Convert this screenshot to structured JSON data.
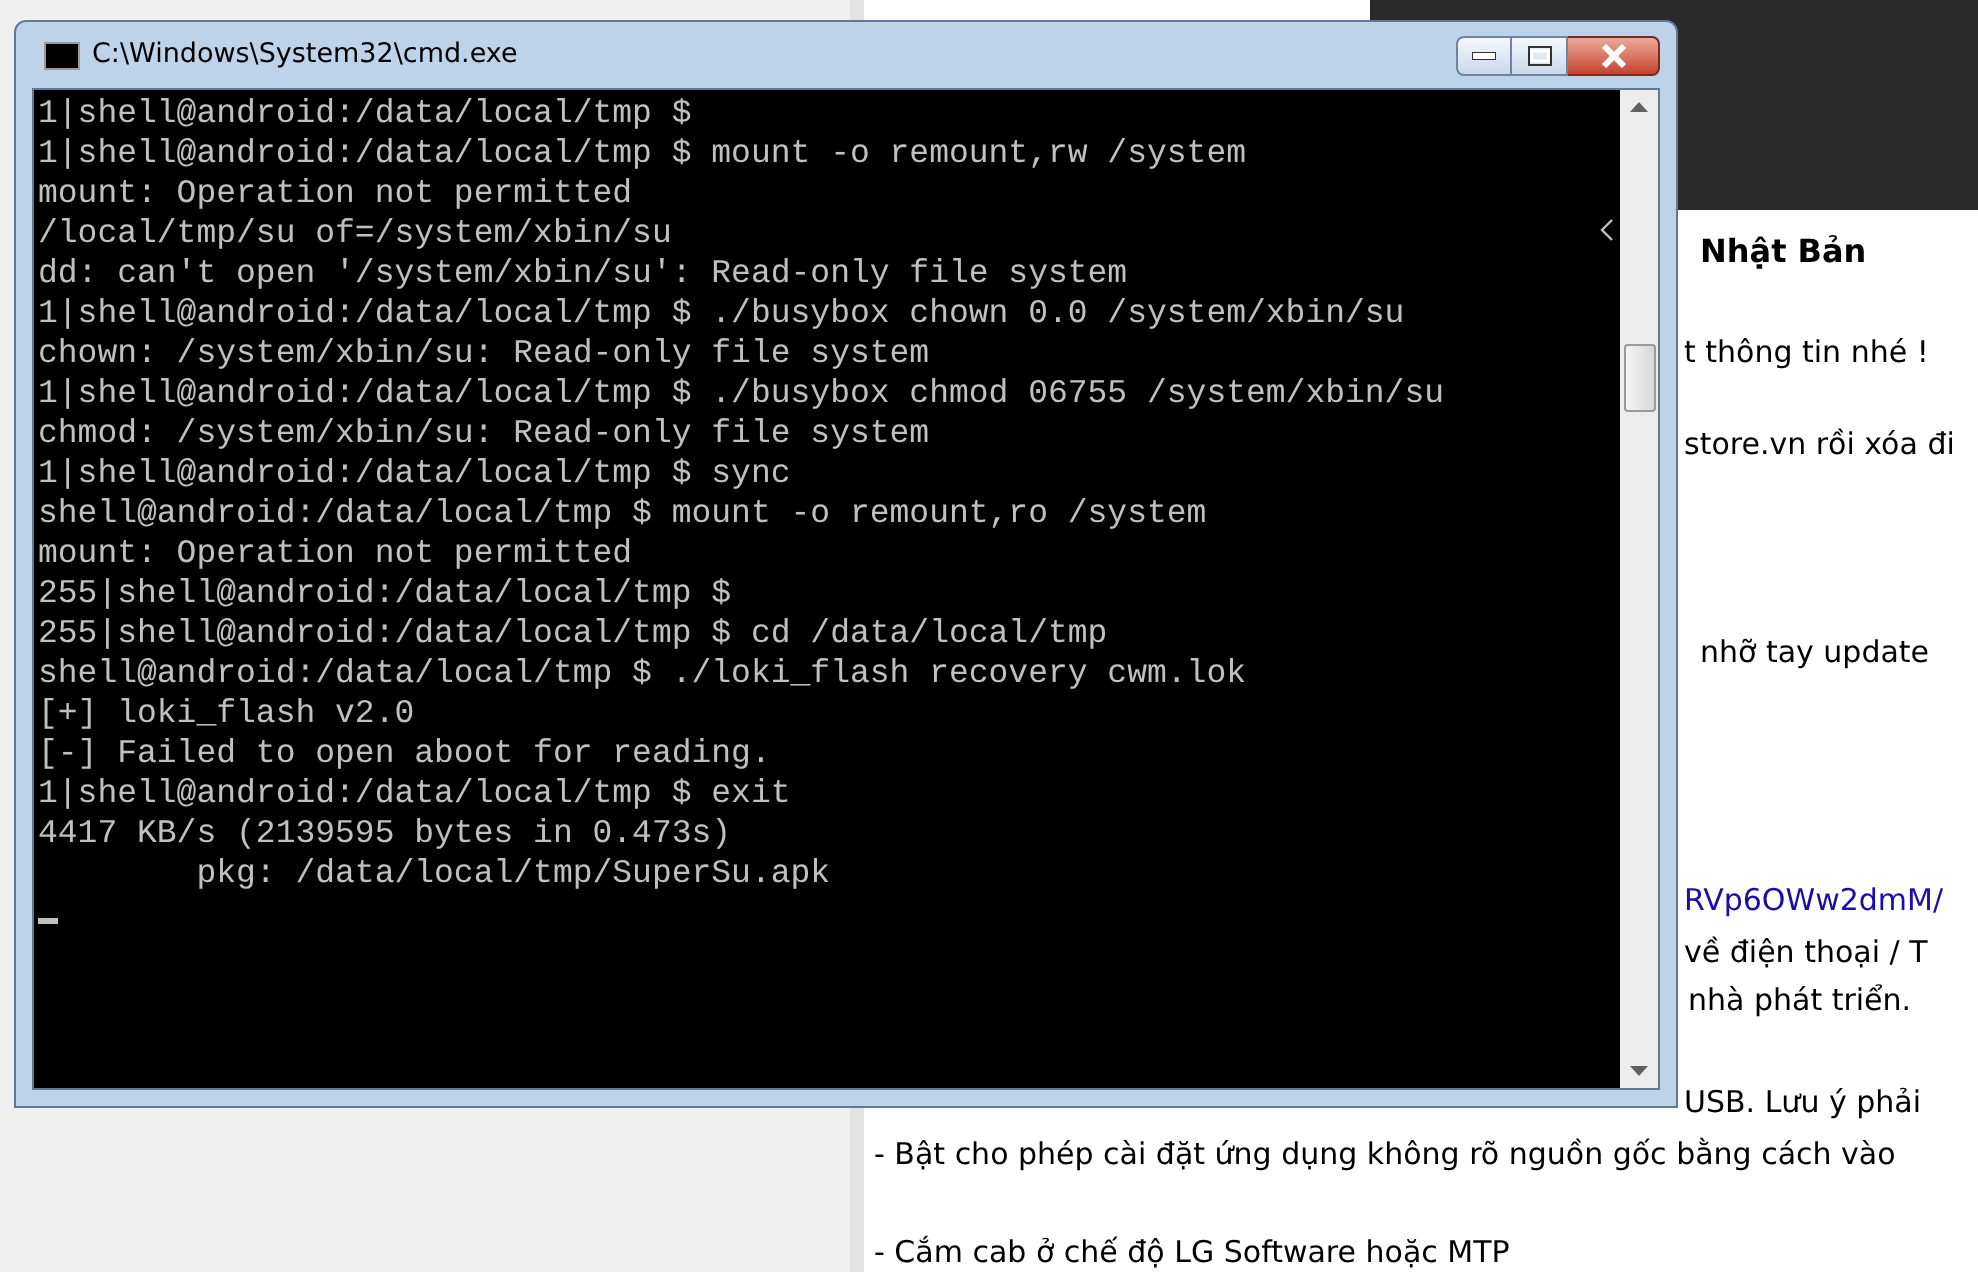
{
  "window": {
    "title": "C:\\Windows\\System32\\cmd.exe"
  },
  "terminal": {
    "lines": [
      "1|shell@android:/data/local/tmp $",
      "1|shell@android:/data/local/tmp $ mount -o remount,rw /system",
      "mount: Operation not permitted",
      "/local/tmp/su of=/system/xbin/su",
      "dd: can't open '/system/xbin/su': Read-only file system",
      "1|shell@android:/data/local/tmp $ ./busybox chown 0.0 /system/xbin/su",
      "chown: /system/xbin/su: Read-only file system",
      "1|shell@android:/data/local/tmp $ ./busybox chmod 06755 /system/xbin/su",
      "chmod: /system/xbin/su: Read-only file system",
      "1|shell@android:/data/local/tmp $ sync",
      "shell@android:/data/local/tmp $ mount -o remount,ro /system",
      "mount: Operation not permitted",
      "255|shell@android:/data/local/tmp $",
      "255|shell@android:/data/local/tmp $ cd /data/local/tmp",
      "shell@android:/data/local/tmp $ ./loki_flash recovery cwm.lok",
      "[+] loki_flash v2.0",
      "[-] Failed to open aboot for reading.",
      "1|shell@android:/data/local/tmp $ exit",
      "4417 KB/s (2139595 bytes in 0.473s)",
      "        pkg: /data/local/tmp/SuperSu.apk"
    ]
  },
  "article": {
    "lines": [
      {
        "kind": "heading",
        "text": "Nhật Bản"
      },
      {
        "kind": "text",
        "text": "t thông tin nhé !"
      },
      {
        "kind": "text",
        "text": "store.vn rồi xóa đi"
      },
      {
        "kind": "text",
        "text": "nhỡ tay update"
      },
      {
        "kind": "link",
        "text": "RVp6OWw2dmM/"
      },
      {
        "kind": "text",
        "text": "về điện thoại / T"
      },
      {
        "kind": "text",
        "text": "nhà phát triển."
      },
      {
        "kind": "text",
        "text": "USB. Lưu ý phải"
      }
    ],
    "list_items": [
      "- Bật cho phép cài đặt ứng dụng không rõ nguồn gốc bằng cách vào",
      "- Cắm cab ở chế độ LG Software hoặc MTP"
    ]
  }
}
